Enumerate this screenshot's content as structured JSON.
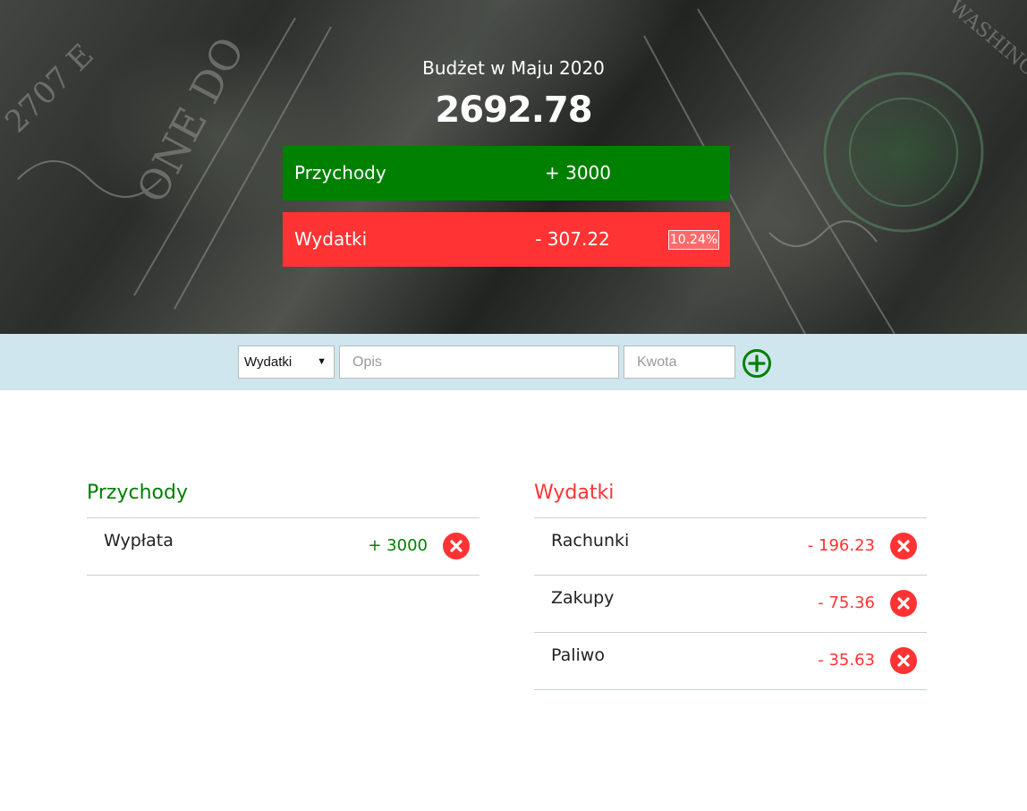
{
  "header": {
    "title": "Budżet w Maju 2020",
    "total": "2692.78",
    "income": {
      "label": "Przychody",
      "value": "+ 3000"
    },
    "expenses": {
      "label": "Wydatki",
      "value": "- 307.22",
      "percent": "10.24%"
    }
  },
  "add_form": {
    "type_selected": "Wydatki",
    "description_placeholder": "Opis",
    "amount_placeholder": "Kwota",
    "add_icon": "plus-circle-icon"
  },
  "income_list": {
    "title": "Przychody",
    "items": [
      {
        "description": "Wypłata",
        "amount": "+ 3000"
      }
    ]
  },
  "expense_list": {
    "title": "Wydatki",
    "items": [
      {
        "description": "Rachunki",
        "amount": "- 196.23"
      },
      {
        "description": "Zakupy",
        "amount": "- 75.36"
      },
      {
        "description": "Paliwo",
        "amount": "- 35.63"
      }
    ]
  },
  "colors": {
    "income": "#008000",
    "expense": "#ff3333",
    "add_bar": "#cfe6ee",
    "delete_icon": "#ff3333"
  }
}
